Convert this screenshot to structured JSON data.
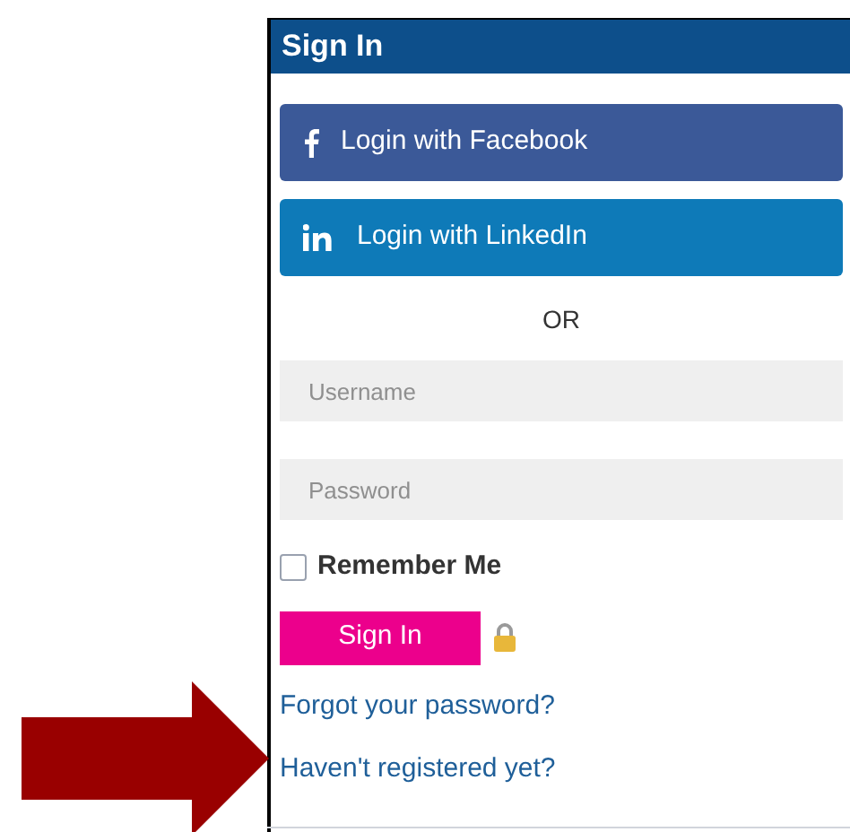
{
  "panel": {
    "title": "Sign In"
  },
  "social_buttons": [
    {
      "kind": "facebook",
      "label": "Login with Facebook"
    },
    {
      "kind": "linkedin",
      "label": "Login with LinkedIn"
    }
  ],
  "separator": "OR",
  "fields": [
    {
      "placeholder": "Username"
    },
    {
      "placeholder": "Password"
    }
  ],
  "remember_me": {
    "label": "Remember Me",
    "checked": false
  },
  "sign_in_button": "Sign In",
  "links": [
    "Forgot your password?",
    "Haven't registered yet?"
  ]
}
